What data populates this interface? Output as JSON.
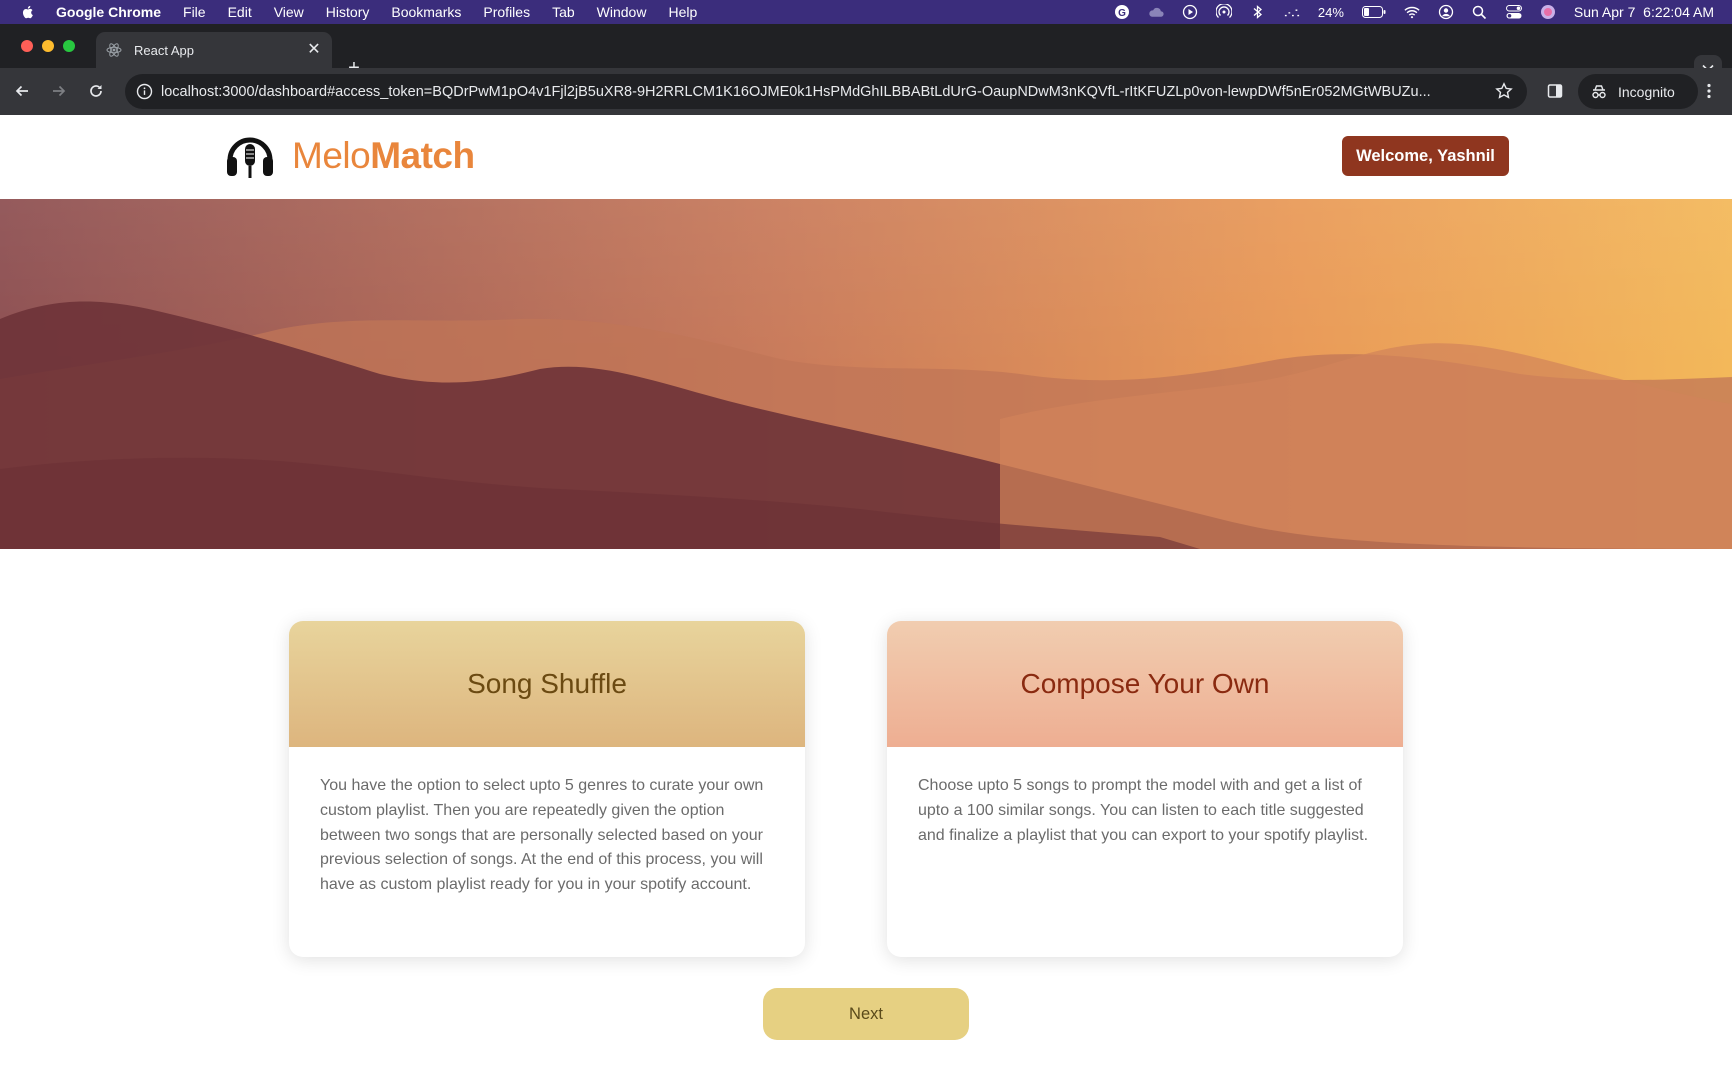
{
  "menubar": {
    "app_name": "Google Chrome",
    "items": [
      "File",
      "Edit",
      "View",
      "History",
      "Bookmarks",
      "Profiles",
      "Tab",
      "Window",
      "Help"
    ],
    "battery": "24%",
    "datetime": "Sun Apr 7  6:22:04 AM"
  },
  "browser": {
    "tab_title": "React App",
    "url": "localhost:3000/dashboard#access_token=BQDrPwM1pO4v1Fjl2jB5uXR8-9H2RRLCM1K16OJME0k1HsPMdGhILBBABtLdUrG-OaupNDwM3nKQVfL-rItKFUZLp0von-lewpDWf5nEr052MGtWBUZu...",
    "incognito_label": "Incognito"
  },
  "header": {
    "logo_light": "Melo",
    "logo_bold": "Match",
    "welcome_label": "Welcome, Yashnil"
  },
  "cards": [
    {
      "title": "Song Shuffle",
      "description": "You have the option to select upto 5 genres to curate your own custom playlist. Then you are repeatedly given the option between two songs that are personally selected based on your previous selection of songs. At the end of this process, you will have as custom playlist ready for you in your spotify account."
    },
    {
      "title": "Compose Your Own",
      "description": "Choose upto 5 songs to prompt the model with and get a list of upto a 100 similar songs. You can listen to each title suggested and finalize a playlist that you can export to your spotify playlist."
    }
  ],
  "next_label": "Next",
  "colors": {
    "menubar_bg": "#3b2d7c",
    "brand_orange": "#e9863c",
    "welcome_bg": "#8f361f",
    "next_bg": "#e6d082"
  }
}
